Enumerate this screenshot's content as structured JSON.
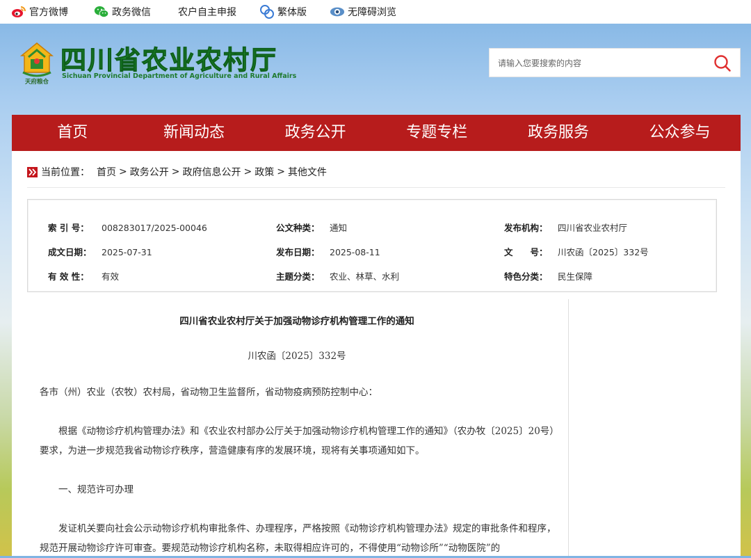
{
  "topbar": {
    "weibo": "官方微博",
    "wechat": "政务微信",
    "declare": "农户自主申报",
    "traditional": "繁体版",
    "accessible": "无障碍浏览"
  },
  "header": {
    "title": "四川省农业农村厅",
    "subtitle": "Sichuan Provincial Department of Agriculture and Rural Affairs",
    "emblem_text": "天府粮仓",
    "search_placeholder": "请输入您要搜索的内容"
  },
  "nav": [
    "首页",
    "新闻动态",
    "政务公开",
    "专题专栏",
    "政务服务",
    "公众参与"
  ],
  "breadcrumb": {
    "label": "当前位置：",
    "items": [
      "首页",
      "政务公开",
      "政府信息公开",
      "政策",
      "其他文件"
    ]
  },
  "meta": {
    "index_no_key": "索 引 号：",
    "index_no": "008283017/2025-00046",
    "doc_type_key": "公文种类：",
    "doc_type": "通知",
    "publisher_key": "发布机构：",
    "publisher": "四川省农业农村厅",
    "created_key": "成文日期：",
    "created": "2025-07-31",
    "published_key": "发布日期：",
    "published": "2025-08-11",
    "doc_no_key": "文　　号：",
    "doc_no": "川农函〔2025〕332号",
    "validity_key": "有 效 性：",
    "validity": "有效",
    "topic_key": "主题分类：",
    "topic": "农业、林草、水利",
    "feature_key": "特色分类：",
    "feature": "民生保障"
  },
  "article": {
    "title": "四川省农业农村厅关于加强动物诊疗机构管理工作的通知",
    "doc_no": "川农函〔2025〕332号",
    "addressee": "各市（州）农业（农牧）农村局，省动物卫生监督所，省动物疫病预防控制中心：",
    "p1": "　　根据《动物诊疗机构管理办法》和《农业农村部办公厅关于加强动物诊疗机构管理工作的通知》（农办牧〔2025〕20号）要求，为进一步规范我省动物诊疗秩序，营造健康有序的发展环境，现将有关事项通知如下。",
    "section1": "　　一、规范许可办理",
    "p2": "　　发证机关要向社会公示动物诊疗机构审批条件、办理程序，严格按照《动物诊疗机构管理办法》规定的审批条件和程序，规范开展动物诊疗许可审查。要规范动物诊疗机构名称，未取得相应许可的，不得使用“动物诊所”“动物医院”的"
  },
  "colors": {
    "nav_red": "#b71c1c",
    "logo_green": "#1f8a2e",
    "search_icon": "#e03030"
  }
}
